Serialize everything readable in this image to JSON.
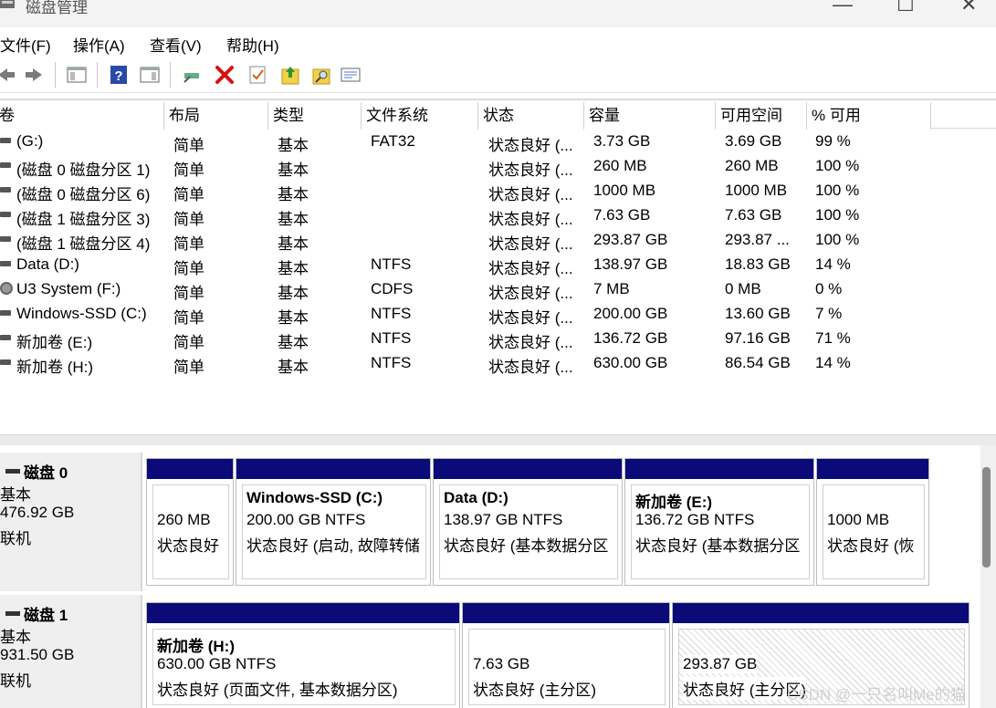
{
  "window": {
    "title": "磁盘管理",
    "minimize": "—",
    "maximize": "☐",
    "close": "✕"
  },
  "menu": [
    "文件(F)",
    "操作(A)",
    "查看(V)",
    "帮助(H)"
  ],
  "columns": [
    "卷",
    "布局",
    "类型",
    "文件系统",
    "状态",
    "容量",
    "可用空间",
    "% 可用"
  ],
  "volumes": [
    {
      "name": "(G:)",
      "layout": "简单",
      "type": "基本",
      "fs": "FAT32",
      "status": "状态良好 (...",
      "capacity": "3.73 GB",
      "free": "3.69 GB",
      "pct": "99 %",
      "icon": "drive-icon"
    },
    {
      "name": "(磁盘 0 磁盘分区 1)",
      "layout": "简单",
      "type": "基本",
      "fs": "",
      "status": "状态良好 (...",
      "capacity": "260 MB",
      "free": "260 MB",
      "pct": "100 %",
      "icon": "drive-icon"
    },
    {
      "name": "(磁盘 0 磁盘分区 6)",
      "layout": "简单",
      "type": "基本",
      "fs": "",
      "status": "状态良好 (...",
      "capacity": "1000 MB",
      "free": "1000 MB",
      "pct": "100 %",
      "icon": "drive-icon"
    },
    {
      "name": "(磁盘 1 磁盘分区 3)",
      "layout": "简单",
      "type": "基本",
      "fs": "",
      "status": "状态良好 (...",
      "capacity": "7.63 GB",
      "free": "7.63 GB",
      "pct": "100 %",
      "icon": "drive-icon"
    },
    {
      "name": "(磁盘 1 磁盘分区 4)",
      "layout": "简单",
      "type": "基本",
      "fs": "",
      "status": "状态良好 (...",
      "capacity": "293.87 GB",
      "free": "293.87 ...",
      "pct": "100 %",
      "icon": "drive-icon"
    },
    {
      "name": "Data (D:)",
      "layout": "简单",
      "type": "基本",
      "fs": "NTFS",
      "status": "状态良好 (...",
      "capacity": "138.97 GB",
      "free": "18.83 GB",
      "pct": "14 %",
      "icon": "drive-icon"
    },
    {
      "name": "U3 System (F:)",
      "layout": "简单",
      "type": "基本",
      "fs": "CDFS",
      "status": "状态良好 (...",
      "capacity": "7 MB",
      "free": "0 MB",
      "pct": "0 %",
      "icon": "cd-icon"
    },
    {
      "name": "Windows-SSD (C:)",
      "layout": "简单",
      "type": "基本",
      "fs": "NTFS",
      "status": "状态良好 (...",
      "capacity": "200.00 GB",
      "free": "13.60 GB",
      "pct": "7 %",
      "icon": "drive-icon"
    },
    {
      "name": "新加卷 (E:)",
      "layout": "简单",
      "type": "基本",
      "fs": "NTFS",
      "status": "状态良好 (...",
      "capacity": "136.72 GB",
      "free": "97.16 GB",
      "pct": "71 %",
      "icon": "drive-icon"
    },
    {
      "name": "新加卷 (H:)",
      "layout": "简单",
      "type": "基本",
      "fs": "NTFS",
      "status": "状态良好 (...",
      "capacity": "630.00 GB",
      "free": "86.54 GB",
      "pct": "14 %",
      "icon": "drive-icon"
    }
  ],
  "disks": [
    {
      "name": "磁盘 0",
      "kind": "基本",
      "size": "476.92 GB",
      "state": "联机",
      "partitions": [
        {
          "title": "",
          "line1": "260 MB",
          "line2": "状态良好"
        },
        {
          "title": "Windows-SSD  (C:)",
          "line1": "200.00 GB NTFS",
          "line2": "状态良好 (启动, 故障转储"
        },
        {
          "title": "Data  (D:)",
          "line1": "138.97 GB NTFS",
          "line2": "状态良好 (基本数据分区"
        },
        {
          "title": "新加卷  (E:)",
          "line1": "136.72 GB NTFS",
          "line2": "状态良好 (基本数据分区"
        },
        {
          "title": "",
          "line1": "1000 MB",
          "line2": "状态良好 (恢"
        }
      ]
    },
    {
      "name": "磁盘 1",
      "kind": "基本",
      "size": "931.50 GB",
      "state": "联机",
      "partitions": [
        {
          "title": "新加卷  (H:)",
          "line1": "630.00 GB NTFS",
          "line2": "状态良好 (页面文件, 基本数据分区)"
        },
        {
          "title": "",
          "line1": "7.63 GB",
          "line2": "状态良好 (主分区)"
        },
        {
          "title": "",
          "line1": "293.87 GB",
          "line2": "状态良好 (主分区)"
        }
      ]
    }
  ],
  "watermark": "CSDN @一只名叫Me的猫",
  "colors": {
    "partition_bar": "#0a0a78",
    "label_bg": "#efefef"
  }
}
